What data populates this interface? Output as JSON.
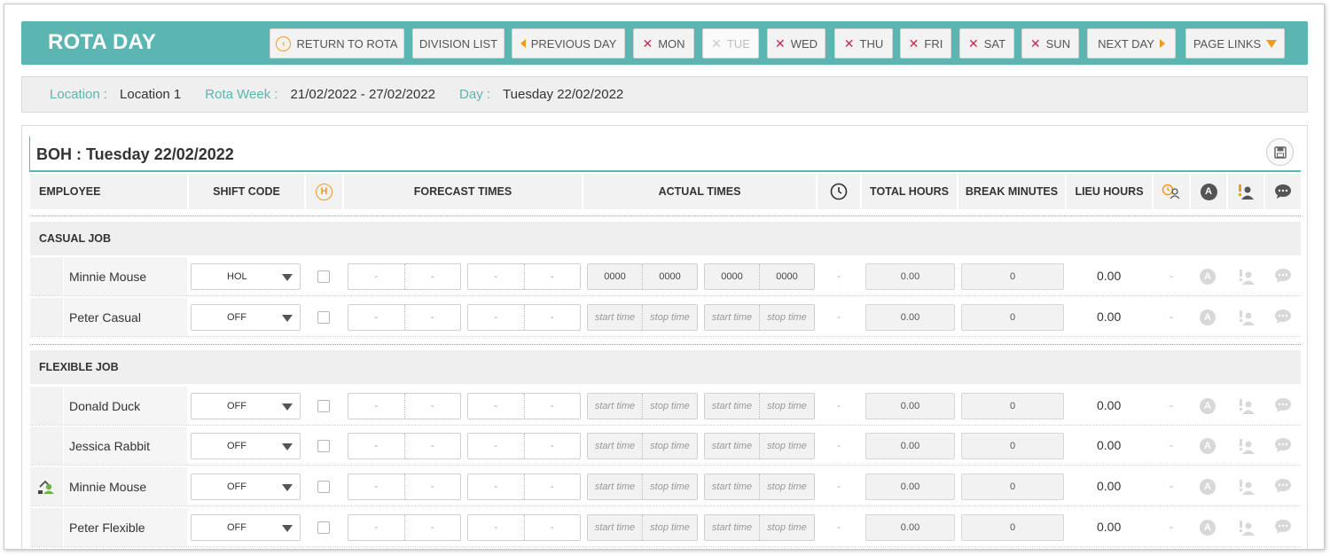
{
  "header": {
    "title": "ROTA DAY",
    "buttons": {
      "return": "RETURN TO ROTA",
      "division": "DIVISION LIST",
      "prev": "PREVIOUS DAY",
      "mon": "MON",
      "tue": "TUE",
      "wed": "WED",
      "thu": "THU",
      "fri": "FRI",
      "sat": "SAT",
      "sun": "SUN",
      "next": "NEXT DAY",
      "links": "PAGE LINKS"
    }
  },
  "info": {
    "location_label": "Location :",
    "location_value": "Location 1",
    "week_label": "Rota Week :",
    "week_value": "21/02/2022 - 27/02/2022",
    "day_label": "Day :",
    "day_value": "Tuesday 22/02/2022"
  },
  "panel": {
    "title": "BOH : Tuesday 22/02/2022",
    "columns": {
      "employee": "EMPLOYEE",
      "shift": "SHIFT CODE",
      "h": "H",
      "forecast": "FORECAST TIMES",
      "actual": "ACTUAL TIMES",
      "total": "TOTAL HOURS",
      "break": "BREAK MINUTES",
      "lieu": "LIEU HOURS",
      "a": "A"
    },
    "groups": {
      "casual": "CASUAL JOB",
      "flexible": "FLEXIBLE JOB"
    },
    "rows": [
      {
        "name": "Minnie Mouse",
        "shift": "HOL",
        "a1": "0000",
        "a2": "0000",
        "a3": "0000",
        "a4": "0000",
        "total": "0.00",
        "break": "0",
        "lieu": "0.00"
      },
      {
        "name": "Peter Casual",
        "shift": "OFF",
        "a1": "start time",
        "a2": "stop time",
        "a3": "start time",
        "a4": "stop time",
        "total": "0.00",
        "break": "0",
        "lieu": "0.00"
      },
      {
        "name": "Donald Duck",
        "shift": "OFF",
        "a1": "start time",
        "a2": "stop time",
        "a3": "start time",
        "a4": "stop time",
        "total": "0.00",
        "break": "0",
        "lieu": "0.00"
      },
      {
        "name": "Jessica Rabbit",
        "shift": "OFF",
        "a1": "start time",
        "a2": "stop time",
        "a3": "start time",
        "a4": "stop time",
        "total": "0.00",
        "break": "0",
        "lieu": "0.00"
      },
      {
        "name": "Minnie Mouse",
        "shift": "OFF",
        "a1": "start time",
        "a2": "stop time",
        "a3": "start time",
        "a4": "stop time",
        "total": "0.00",
        "break": "0",
        "lieu": "0.00"
      },
      {
        "name": "Peter Flexible",
        "shift": "OFF",
        "a1": "start time",
        "a2": "stop time",
        "a3": "start time",
        "a4": "stop time",
        "total": "0.00",
        "break": "0",
        "lieu": "0.00"
      }
    ],
    "dash": "-",
    "a_letter": "A"
  },
  "colors": {
    "teal": "#5bb5b1",
    "orange": "#f39a1e",
    "red_x": "#d0234a"
  }
}
